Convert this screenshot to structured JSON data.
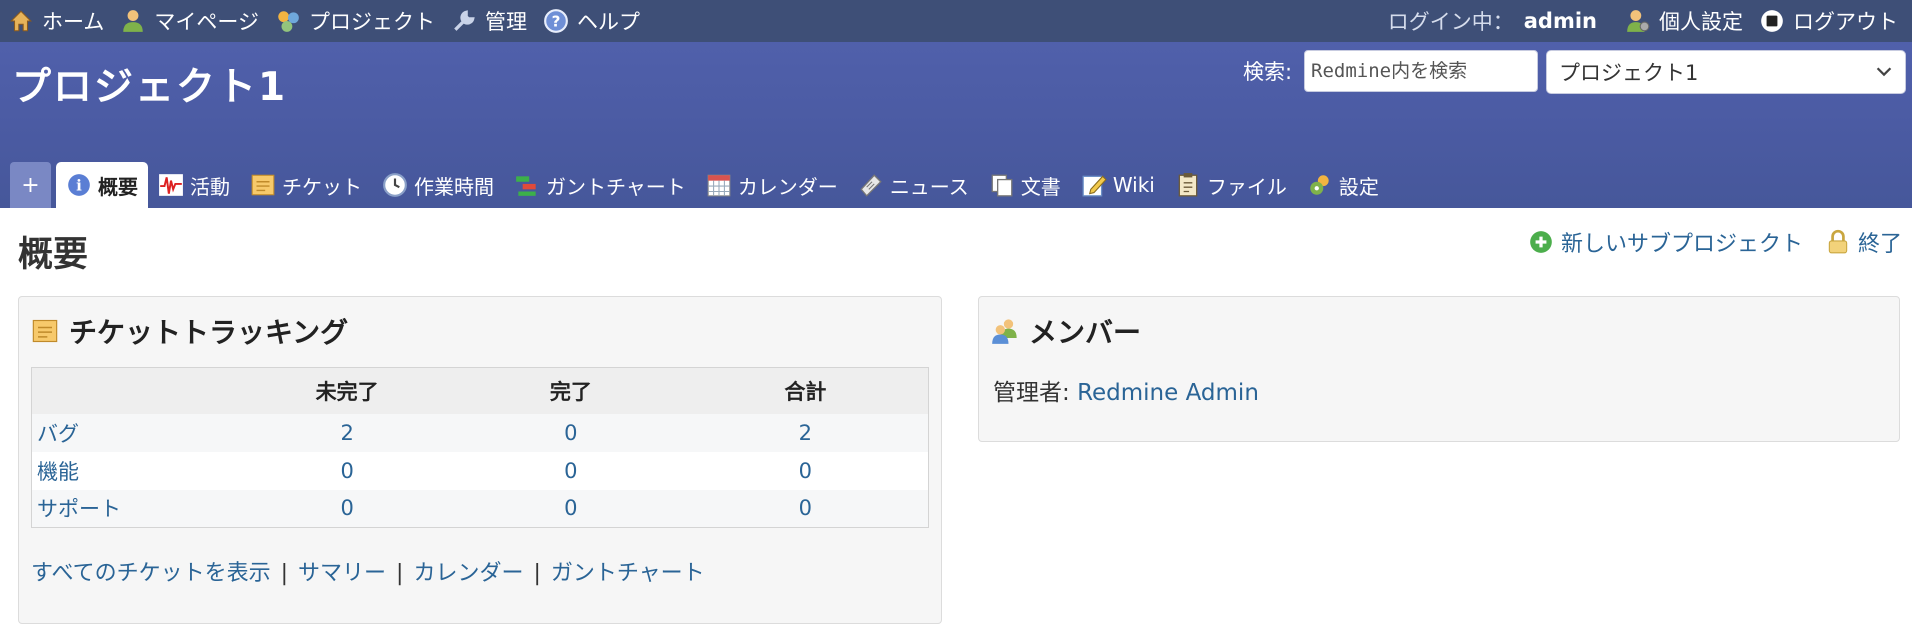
{
  "top_menu": {
    "items": [
      "ホーム",
      "マイページ",
      "プロジェクト",
      "管理",
      "ヘルプ"
    ],
    "logged_as_label": "ログイン中：",
    "user": "admin",
    "my_account": "個人設定",
    "logout": "ログアウト"
  },
  "header": {
    "project_title": "プロジェクト1",
    "search_label": "検索:",
    "search_placeholder": "Redmine内を検索",
    "project_jump_value": "プロジェクト1"
  },
  "tabs": {
    "new_object": "+",
    "items": [
      "概要",
      "活動",
      "チケット",
      "作業時間",
      "ガントチャート",
      "カレンダー",
      "ニュース",
      "文書",
      "Wiki",
      "ファイル",
      "設定"
    ],
    "selected": "概要"
  },
  "page": {
    "heading": "概要",
    "new_subproject": "新しいサブプロジェクト",
    "close": "終了"
  },
  "issue_tracking": {
    "title": "チケットトラッキング",
    "columns": [
      "",
      "未完了",
      "完了",
      "合計"
    ],
    "rows": [
      {
        "name": "バグ",
        "open": "2",
        "closed": "0",
        "total": "2"
      },
      {
        "name": "機能",
        "open": "0",
        "closed": "0",
        "total": "0"
      },
      {
        "name": "サポート",
        "open": "0",
        "closed": "0",
        "total": "0"
      }
    ],
    "links": [
      "すべてのチケットを表示",
      "サマリー",
      "カレンダー",
      "ガントチャート"
    ],
    "separator": "|"
  },
  "members": {
    "title": "メンバー",
    "role": "管理者:",
    "user": "Redmine Admin"
  },
  "colors": {
    "top_menu_bg": "#3e4f77",
    "header_bg": "#4b5ba3",
    "link": "#2a6496",
    "box_bg": "#f6f6f6"
  },
  "icons": {
    "top_menu": [
      "home-icon",
      "user-icon",
      "projects-icon",
      "admin-wrench-icon",
      "help-icon"
    ],
    "my_account": "user-settings-icon",
    "logout": "logout-icon",
    "tabs": [
      "info-icon",
      "activity-icon",
      "ticket-icon",
      "clock-icon",
      "gantt-icon",
      "calendar-icon",
      "news-icon",
      "documents-icon",
      "wiki-icon",
      "files-icon",
      "settings-icon"
    ]
  }
}
